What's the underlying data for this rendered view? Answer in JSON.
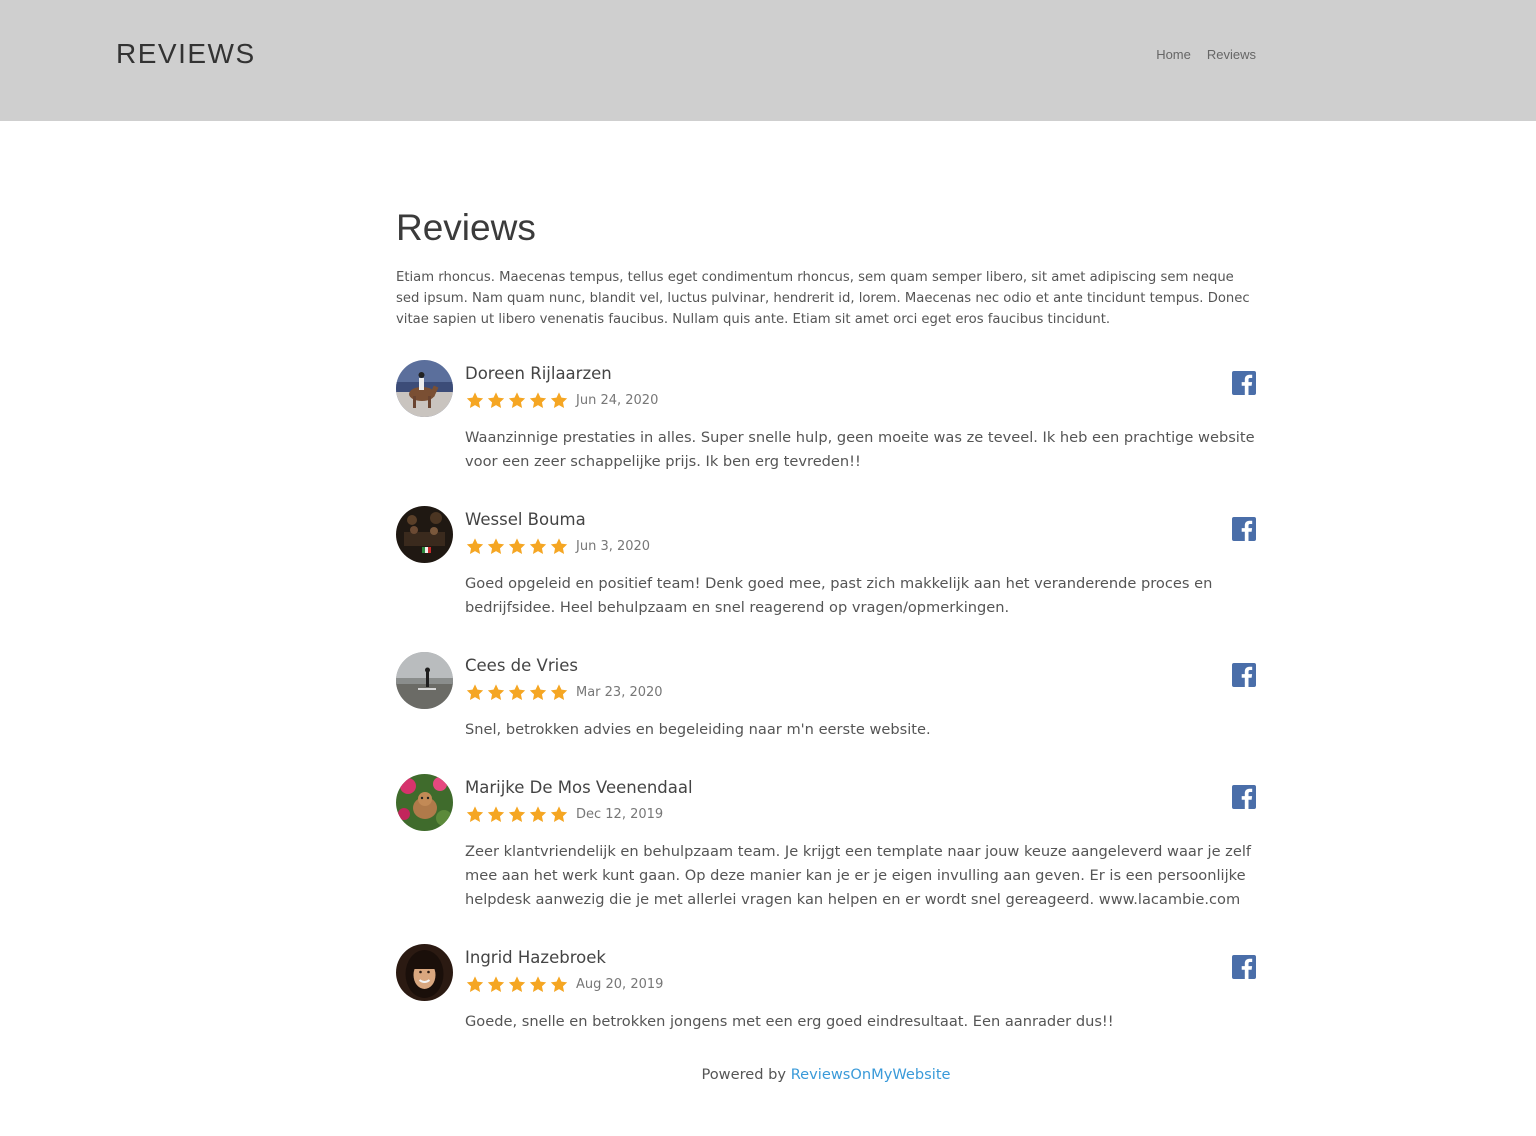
{
  "header": {
    "brand": "REVIEWS",
    "nav": [
      {
        "label": "Home"
      },
      {
        "label": "Reviews"
      }
    ]
  },
  "page": {
    "title": "Reviews",
    "intro": "Etiam rhoncus. Maecenas tempus, tellus eget condimentum rhoncus, sem quam semper libero, sit amet adipiscing sem neque sed ipsum. Nam quam nunc, blandit vel, luctus pulvinar, hendrerit id, lorem. Maecenas nec odio et ante tincidunt tempus. Donec vitae sapien ut libero venenatis faucibus. Nullam quis ante. Etiam sit amet orci eget eros faucibus tincidunt."
  },
  "reviews": [
    {
      "name": "Doreen Rijlaarzen",
      "rating": 5,
      "date": "Jun 24, 2020",
      "text": "Waanzinnige prestaties in alles. Super snelle hulp, geen moeite was ze teveel. Ik heb een prachtige website voor een zeer schappelijke prijs. Ik ben erg tevreden!!",
      "source_icon": "facebook-icon"
    },
    {
      "name": "Wessel Bouma",
      "rating": 5,
      "date": "Jun 3, 2020",
      "text": "Goed opgeleid en positief team! Denk goed mee, past zich makkelijk aan het veranderende proces en bedrijfsidee. Heel behulpzaam en snel reagerend op vragen/opmerkingen.",
      "source_icon": "facebook-icon"
    },
    {
      "name": "Cees de Vries",
      "rating": 5,
      "date": "Mar 23, 2020",
      "text": "Snel, betrokken advies en begeleiding naar m'n eerste website.",
      "source_icon": "facebook-icon"
    },
    {
      "name": "Marijke De Mos Veenendaal",
      "rating": 5,
      "date": "Dec 12, 2019",
      "text": "Zeer klantvriendelijk en behulpzaam team. Je krijgt een template naar jouw keuze aangeleverd waar je zelf mee aan het werk kunt gaan. Op deze manier kan je er je eigen invulling aan geven. Er is een persoonlijke helpdesk aanwezig die je met allerlei vragen kan helpen en er wordt snel gereageerd. www.lacambie.com",
      "source_icon": "facebook-icon"
    },
    {
      "name": "Ingrid Hazebroek",
      "rating": 5,
      "date": "Aug 20, 2019",
      "text": "Goede, snelle en betrokken jongens met een erg goed eindresultaat. Een aanrader dus!!",
      "source_icon": "facebook-icon"
    }
  ],
  "footer": {
    "powered_prefix": "Powered by",
    "powered_link": "ReviewsOnMyWebsite"
  },
  "colors": {
    "header_bg": "#cfcfcf",
    "star": "#f5a623",
    "facebook": "#4a6ea9",
    "link": "#3a9ad9"
  }
}
